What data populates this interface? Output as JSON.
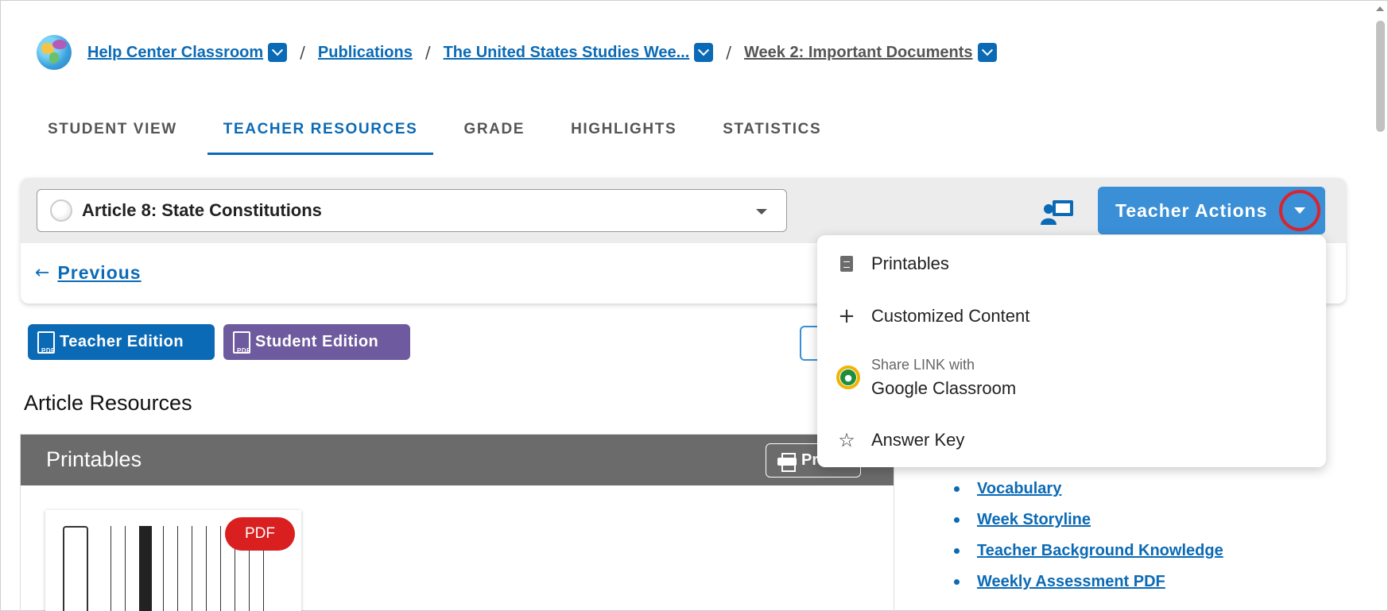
{
  "breadcrumb": {
    "items": [
      {
        "label": "Help Center Classroom",
        "has_dropdown": true
      },
      {
        "label": "Publications",
        "has_dropdown": false
      },
      {
        "label": "The United States Studies Wee...",
        "has_dropdown": true
      },
      {
        "label": "Week 2: Important Documents",
        "has_dropdown": true
      }
    ],
    "separator": "/"
  },
  "tabs": [
    {
      "label": "STUDENT VIEW",
      "active": false
    },
    {
      "label": "TEACHER RESOURCES",
      "active": true
    },
    {
      "label": "GRADE",
      "active": false
    },
    {
      "label": "HIGHLIGHTS",
      "active": false
    },
    {
      "label": "STATISTICS",
      "active": false
    }
  ],
  "article": {
    "selected": "Article 8: State Constitutions",
    "teacher_actions_label": "Teacher Actions",
    "previous_label": "Previous"
  },
  "editions": {
    "teacher_label": "Teacher Edition",
    "student_label": "Student Edition"
  },
  "resources": {
    "heading": "Article Resources",
    "printables_title": "Printables",
    "print_button": "Pr",
    "pdf_badge": "PDF",
    "links": [
      "Vocabulary",
      "Week Storyline",
      "Teacher Background Knowledge",
      "Weekly Assessment PDF"
    ]
  },
  "menu": {
    "items": [
      {
        "label": "Printables",
        "icon": "document-icon"
      },
      {
        "label": "Customized Content",
        "icon": "plus-icon"
      },
      {
        "sublabel": "Share LINK with",
        "label": "Google Classroom",
        "icon": "google-classroom-icon"
      },
      {
        "label": "Answer Key",
        "icon": "star-icon"
      }
    ]
  },
  "colors": {
    "accent": "#0b6ab5",
    "teacher_actions": "#3a8fd6",
    "student_edition": "#6e5a9e",
    "pdf_badge": "#d91f1f",
    "highlight_ring": "#d9242e"
  }
}
